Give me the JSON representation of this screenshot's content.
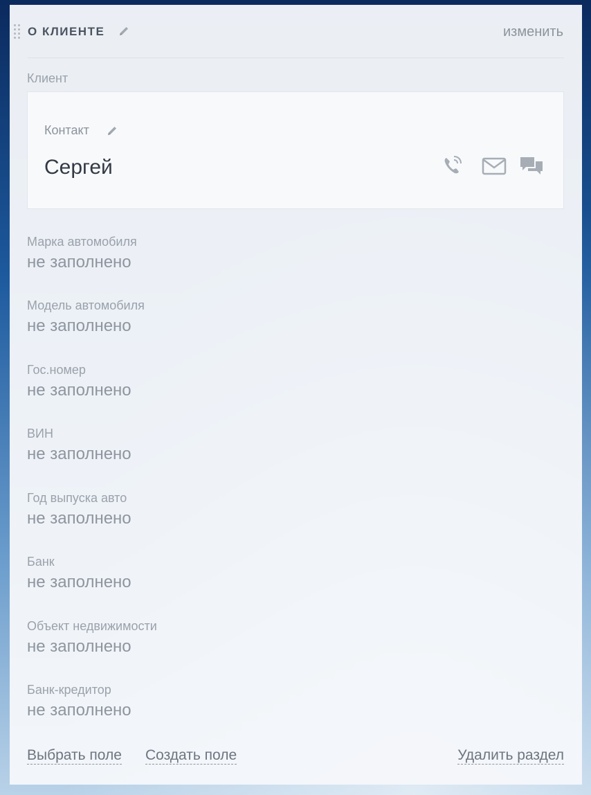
{
  "section": {
    "title": "О КЛИЕНТЕ",
    "change_label": "изменить"
  },
  "client": {
    "label": "Клиент",
    "contact_label": "Контакт",
    "contact_name": "Сергей",
    "actions": [
      {
        "icon": "phone-icon"
      },
      {
        "icon": "mail-icon"
      },
      {
        "icon": "chat-icon"
      }
    ]
  },
  "fields": [
    {
      "label": "Марка автомобиля",
      "value": "не заполнено"
    },
    {
      "label": "Модель автомобиля",
      "value": "не заполнено"
    },
    {
      "label": "Гос.номер",
      "value": "не заполнено"
    },
    {
      "label": "ВИН",
      "value": "не заполнено"
    },
    {
      "label": "Год выпуска авто",
      "value": "не заполнено"
    },
    {
      "label": "Банк",
      "value": "не заполнено"
    },
    {
      "label": "Объект недвижимости",
      "value": "не заполнено"
    },
    {
      "label": "Банк-кредитор",
      "value": "не заполнено"
    }
  ],
  "footer": {
    "select_field": "Выбрать поле",
    "create_field": "Создать поле",
    "delete_section": "Удалить раздел"
  },
  "colors": {
    "panel_background": "#f5f7fa",
    "text_muted": "#9aa1aa",
    "text_dark": "#333a44",
    "icon_gray": "#a7adb5"
  }
}
